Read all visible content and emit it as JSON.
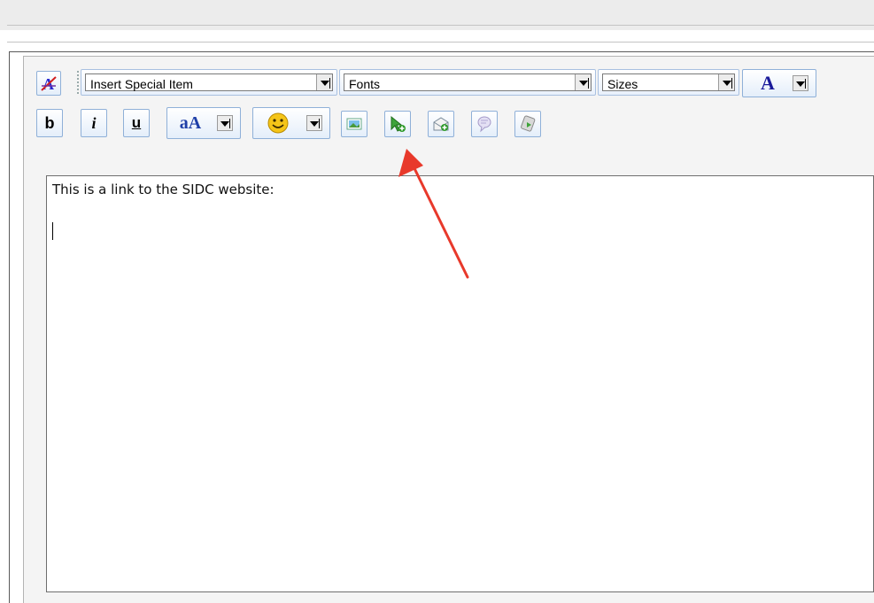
{
  "toolbar": {
    "special_item_label": "Insert Special Item",
    "fonts_label": "Fonts",
    "sizes_label": "Sizes",
    "font_color_glyph": "A",
    "bold_glyph": "b",
    "italic_glyph": "i",
    "underline_glyph": "u",
    "text_style_glyph": "aA",
    "emoticon_glyph": "☺"
  },
  "editor": {
    "content": "This is a link to the SIDC website:"
  },
  "colors": {
    "annotation_arrow": "#e8392b",
    "button_border": "#8fb0d8",
    "insert_link_green": "#3ea33a"
  },
  "icons": [
    "clear-formatting-icon",
    "insert-image-icon",
    "insert-link-icon",
    "insert-email-icon",
    "insert-comment-icon",
    "insert-media-icon"
  ]
}
